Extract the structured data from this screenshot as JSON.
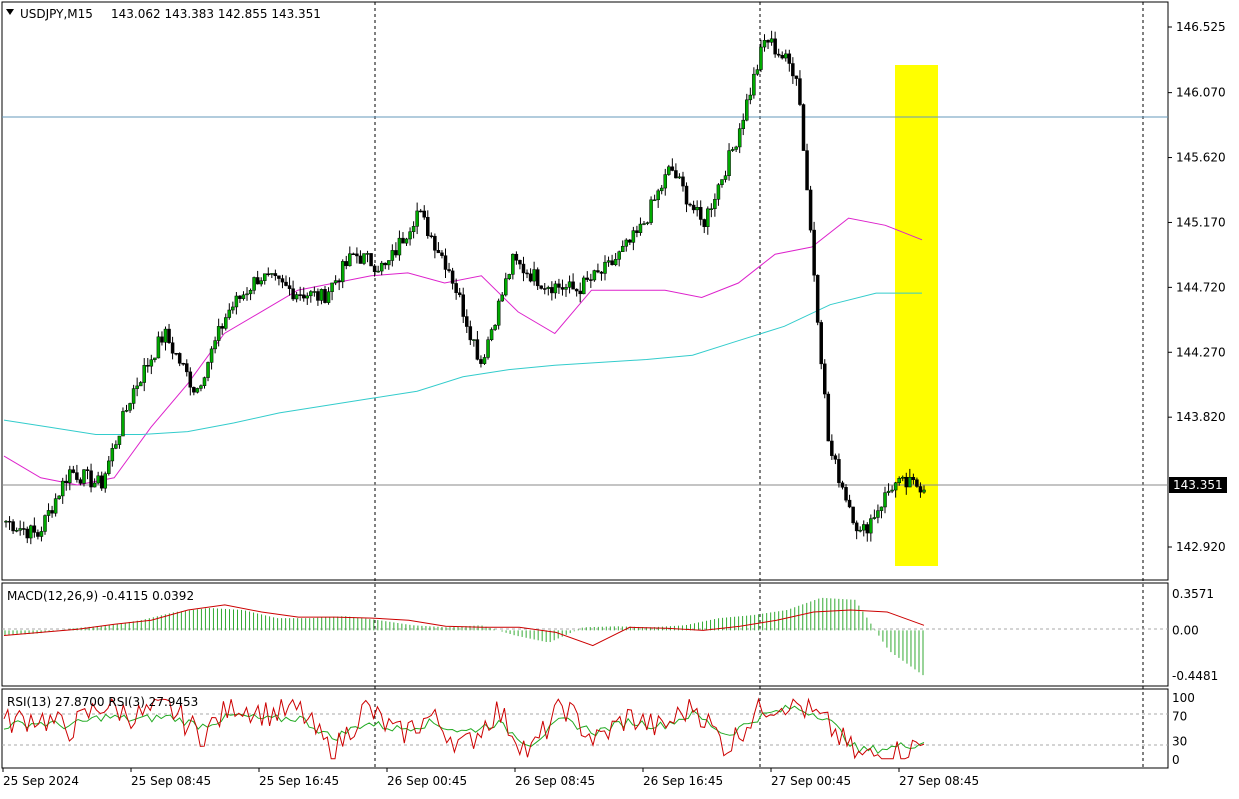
{
  "header": {
    "symbol": "USDJPY,M15",
    "ohlc": "143.062 143.383 142.855 143.351"
  },
  "macd_panel": {
    "label": "MACD(12,26,9) -0.4115 0.0392",
    "ticks": [
      "0.3571",
      "0.00",
      "-0.4481"
    ]
  },
  "rsi_panel": {
    "label": "RSI(13) 27.8700  RSI(3) 27.9453",
    "ticks": [
      "100",
      "70",
      "30",
      "0"
    ]
  },
  "price_ticks": [
    "146.525",
    "146.070",
    "145.620",
    "145.170",
    "144.720",
    "144.270",
    "143.820",
    "142.920"
  ],
  "current_price": "143.351",
  "time_labels": [
    "25 Sep 2024",
    "25 Sep 08:45",
    "25 Sep 16:45",
    "26 Sep 00:45",
    "26 Sep 08:45",
    "26 Sep 16:45",
    "27 Sep 00:45",
    "27 Sep 08:45"
  ],
  "colors": {
    "bull_candle": "#00aa00",
    "bear_candle": "#000000",
    "ma_fast": "#dd22cc",
    "ma_slow": "#33cccc",
    "highlight": "#ffff00",
    "macd_hist": "#33aa33",
    "macd_signal": "#cc0000",
    "rsi_fast": "#cc0000",
    "rsi_slow": "#22aa22",
    "price_tag_bg": "#000000",
    "hline_blue": "#6699bb"
  },
  "chart_data": {
    "type": "candlestick",
    "symbol": "USDJPY",
    "timeframe": "M15",
    "y_range": [
      142.8,
      146.62
    ],
    "horizontal_level": 145.88,
    "series": [
      {
        "name": "price",
        "x": [
          "25 Sep 2024",
          "25 Sep 03:00",
          "25 Sep 05:00",
          "25 Sep 08:45",
          "25 Sep 11:00",
          "25 Sep 13:00",
          "25 Sep 15:00",
          "25 Sep 16:45",
          "25 Sep 19:00",
          "25 Sep 22:00",
          "26 Sep 00:45",
          "26 Sep 03:00",
          "26 Sep 05:00",
          "26 Sep 07:00",
          "26 Sep 08:45",
          "26 Sep 11:00",
          "26 Sep 13:00",
          "26 Sep 15:00",
          "26 Sep 16:45",
          "26 Sep 19:00",
          "26 Sep 21:00",
          "26 Sep 23:00",
          "27 Sep 00:45",
          "27 Sep 02:00",
          "27 Sep 03:30",
          "27 Sep 05:00",
          "27 Sep 06:15",
          "27 Sep 07:00",
          "27 Sep 07:45",
          "27 Sep 08:45"
        ],
        "values": [
          143.1,
          143.0,
          143.45,
          143.35,
          144.0,
          144.4,
          144.0,
          144.55,
          144.8,
          144.7,
          144.65,
          144.95,
          144.85,
          145.25,
          144.85,
          144.2,
          144.9,
          144.75,
          144.7,
          144.85,
          145.1,
          145.55,
          145.15,
          145.7,
          146.45,
          146.2,
          143.6,
          143.0,
          143.35,
          143.35
        ]
      },
      {
        "name": "MA fast",
        "values": [
          143.55,
          143.4,
          143.35,
          143.4,
          143.75,
          144.05,
          144.4,
          144.55,
          144.7,
          144.75,
          144.8,
          144.82,
          144.75,
          144.8,
          144.55,
          144.4,
          144.7,
          144.7,
          144.7,
          144.65,
          144.75,
          144.95,
          145.0,
          145.2,
          145.15,
          145.05
        ]
      },
      {
        "name": "MA slow",
        "values": [
          143.8,
          143.75,
          143.7,
          143.7,
          143.72,
          143.78,
          143.85,
          143.9,
          143.95,
          144.0,
          144.1,
          144.15,
          144.18,
          144.2,
          144.22,
          144.25,
          144.35,
          144.45,
          144.6,
          144.68,
          144.68
        ]
      }
    ],
    "macd": {
      "range": [
        -0.4481,
        0.3571
      ],
      "histogram": [
        -0.05,
        -0.03,
        0.02,
        0.05,
        0.1,
        0.18,
        0.22,
        0.2,
        0.12,
        0.12,
        0.14,
        0.1,
        0.05,
        0.03,
        0.05,
        -0.05,
        -0.12,
        0.03,
        0.04,
        0.03,
        0.05,
        0.12,
        0.15,
        0.2,
        0.32,
        0.3,
        -0.2,
        -0.44
      ],
      "signal": [
        -0.05,
        -0.02,
        0.01,
        0.06,
        0.1,
        0.2,
        0.25,
        0.18,
        0.13,
        0.13,
        0.12,
        0.1,
        0.04,
        0.03,
        0.03,
        -0.02,
        -0.15,
        0.03,
        0.02,
        0.0,
        0.04,
        0.1,
        0.18,
        0.2,
        0.18,
        0.05
      ]
    },
    "rsi": {
      "range": [
        0,
        100
      ],
      "levels": [
        70,
        30
      ],
      "rsi3": [
        60,
        70,
        50,
        90,
        70,
        85,
        40,
        90,
        75,
        80,
        10,
        85,
        40,
        70,
        20,
        80,
        10,
        90,
        30,
        70,
        50,
        90,
        20,
        85,
        95,
        60,
        5,
        10,
        25
      ],
      "rsi13": [
        55,
        60,
        55,
        70,
        65,
        70,
        55,
        72,
        65,
        68,
        35,
        60,
        50,
        60,
        45,
        60,
        25,
        65,
        45,
        62,
        55,
        75,
        40,
        70,
        85,
        70,
        15,
        20,
        28
      ]
    }
  }
}
